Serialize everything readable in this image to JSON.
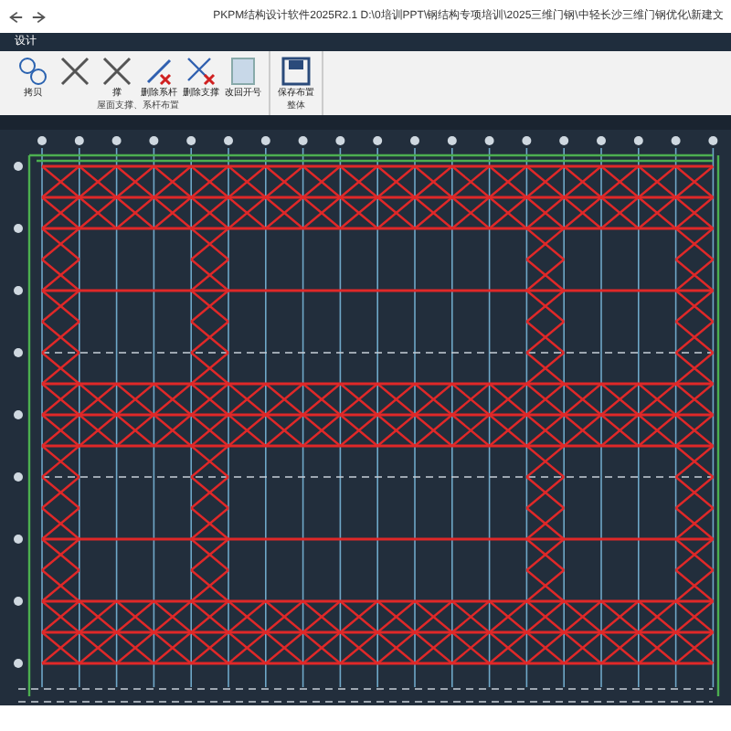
{
  "window": {
    "title": "PKPM结构设计软件2025R2.1 D:\\0培训PPT\\钢结构专项培训\\2025三维门钢\\中轻长沙三维门钢优化\\新建文"
  },
  "menu_tabs": [
    {
      "label": "设计",
      "selected": true
    }
  ],
  "ribbon": {
    "groups": [
      {
        "label": "屋面支撑、系杆布置",
        "buttons": [
          {
            "kind": "copy",
            "label": "拷贝"
          },
          {
            "kind": "brace"
          },
          {
            "kind": "brace",
            "label": "撑"
          },
          {
            "kind": "delete-tie",
            "label": "删除系杆"
          },
          {
            "kind": "delete-brace",
            "label": "删除支撑"
          },
          {
            "kind": "renumber",
            "label": "改回开号"
          }
        ]
      },
      {
        "label": "整体",
        "buttons": [
          {
            "kind": "save",
            "label": "保存布置"
          }
        ]
      }
    ]
  }
}
